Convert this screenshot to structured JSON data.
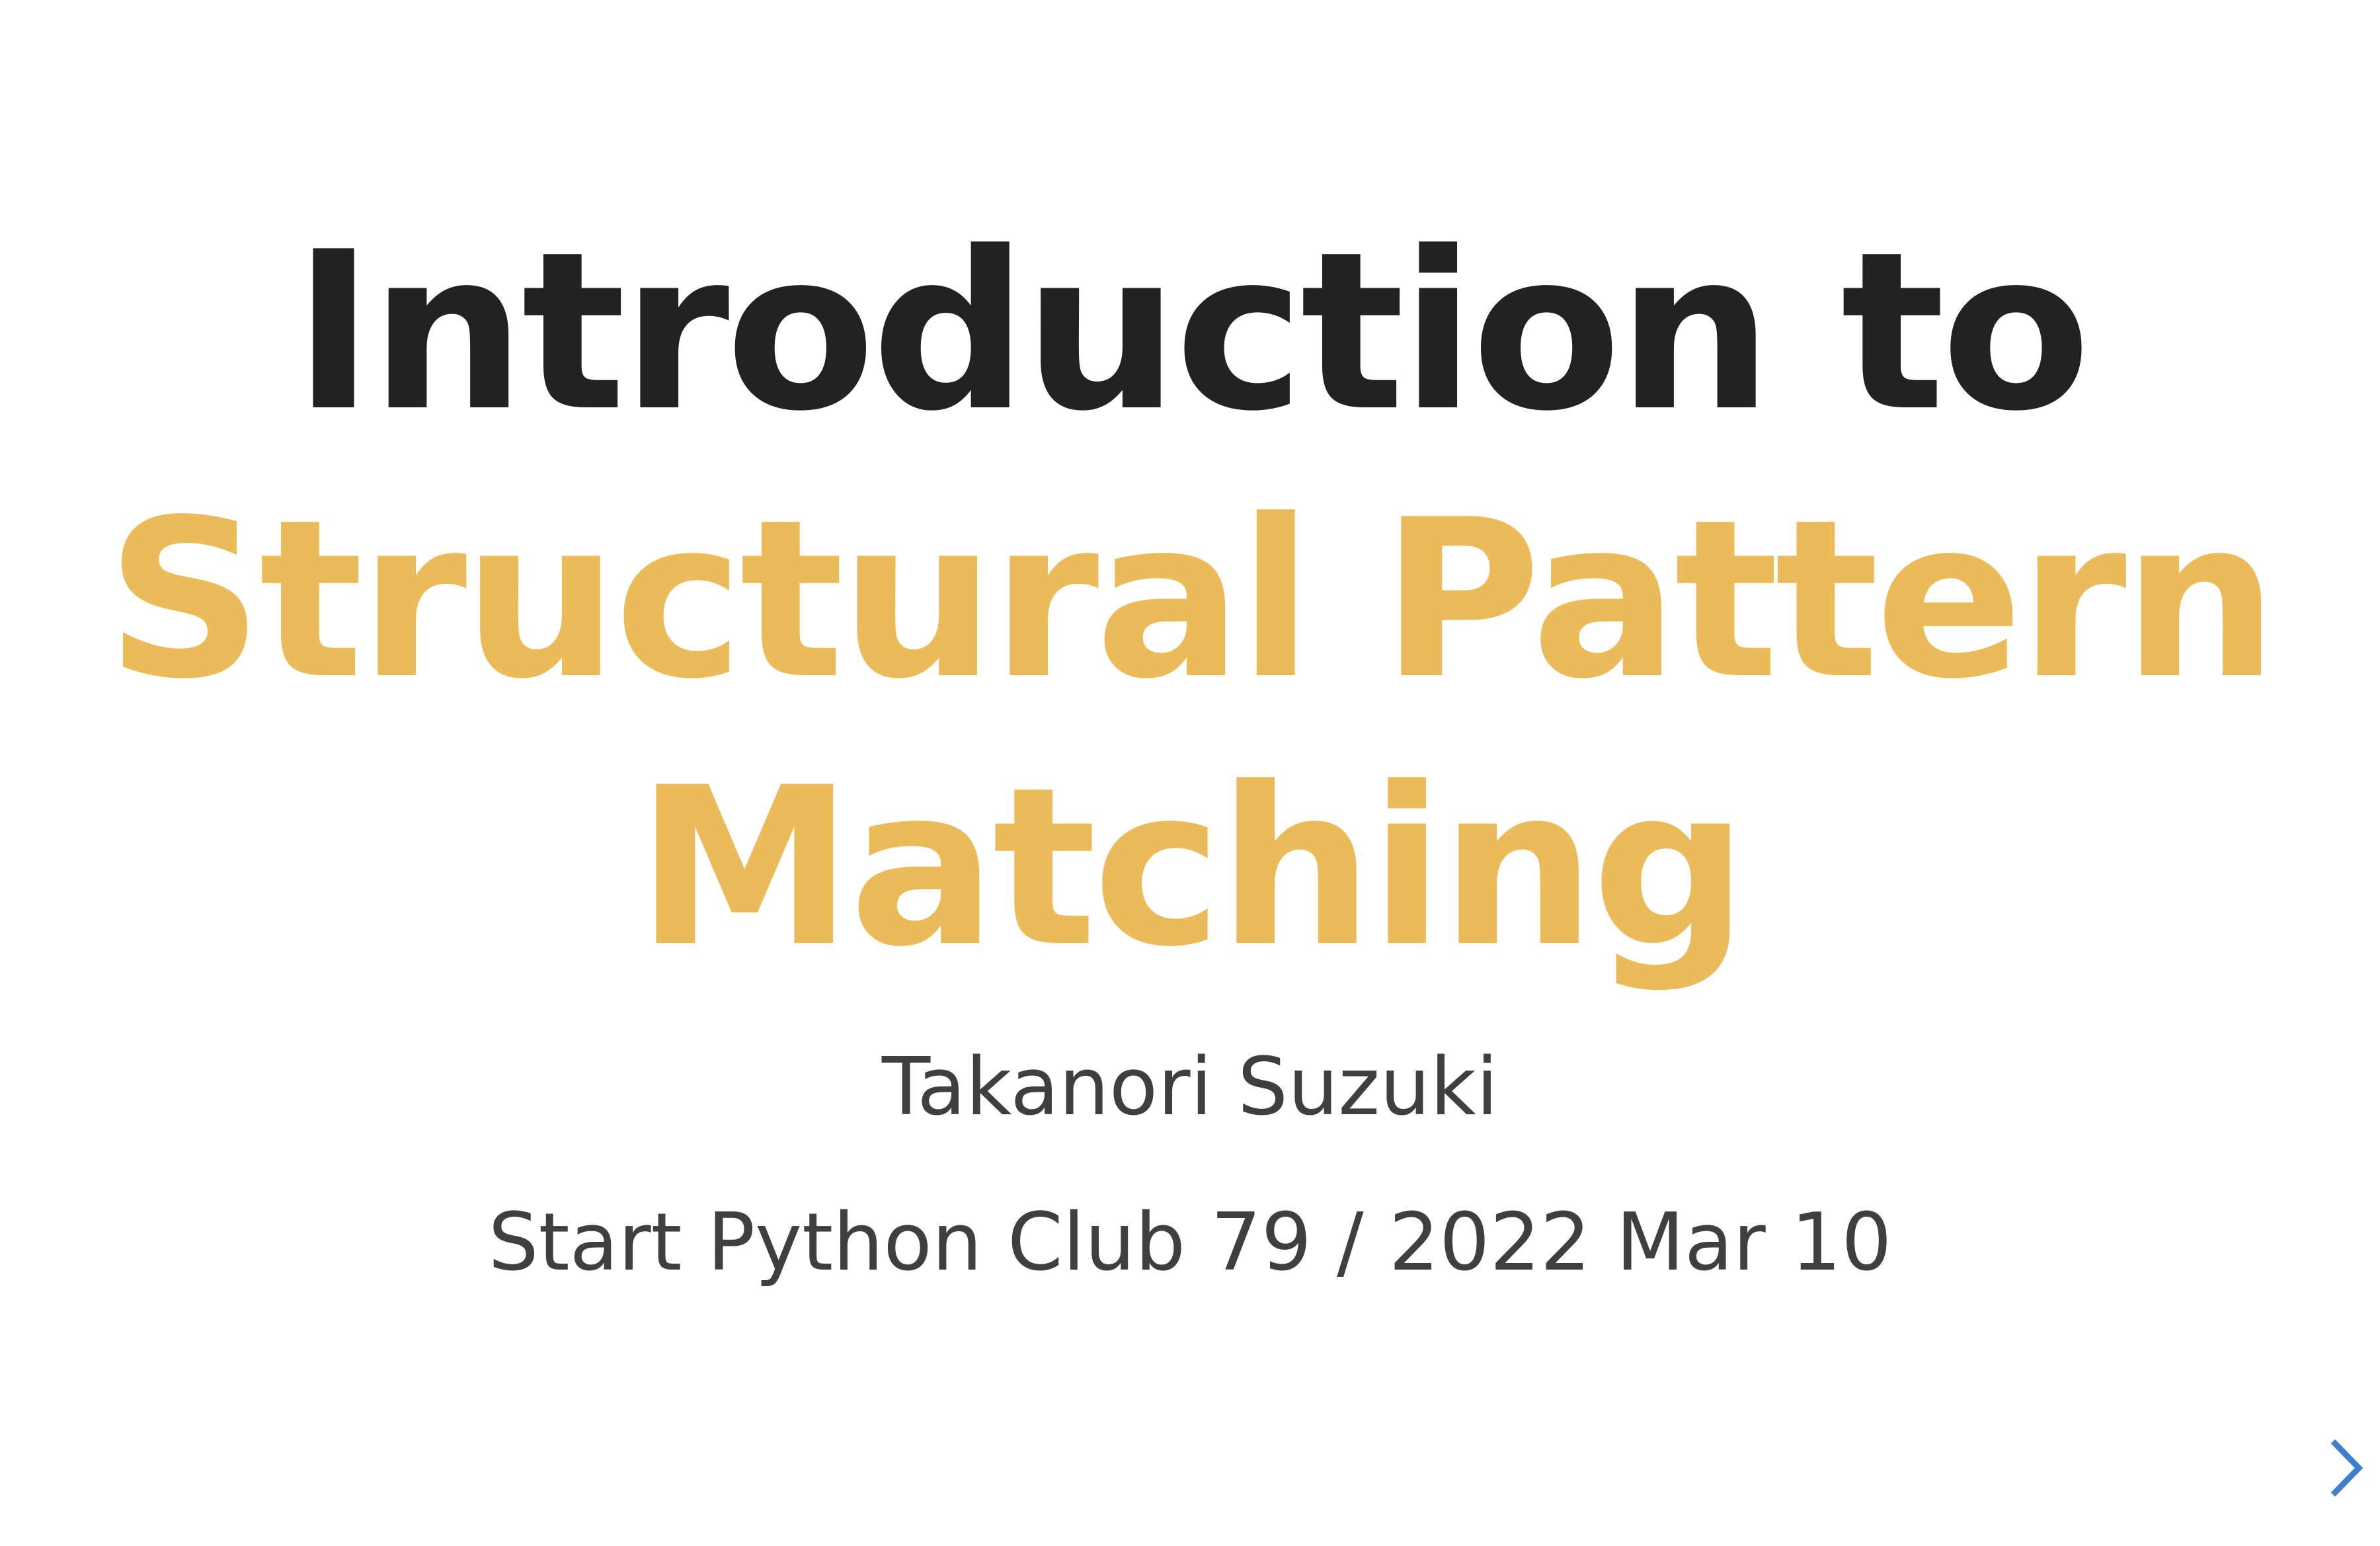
{
  "slide": {
    "title_line_1": "Introduction to",
    "title_line_2": "Structural Pattern Matching",
    "author": "Takanori Suzuki",
    "event": "Start Python Club 79 / 2022 Mar 10"
  },
  "controls": {
    "next_icon": "chevron-right-icon",
    "next_color": "#3f7fd1"
  },
  "colors": {
    "title_dark": "#222222",
    "title_accent": "#ebbb59",
    "body_text": "#3f3f3f"
  }
}
